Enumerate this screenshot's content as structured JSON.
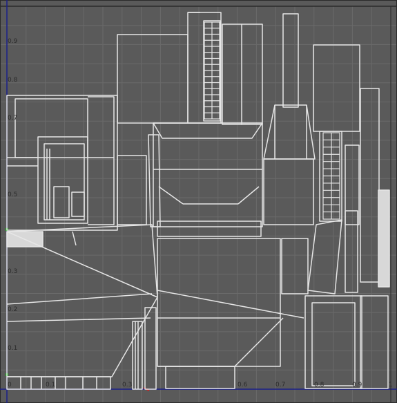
{
  "uv_editor": {
    "axis_ticks": {
      "v": [
        "0.9",
        "0.8",
        "0.7",
        "0.5",
        "0.3",
        "0.2",
        "0.1"
      ],
      "u": [
        "0",
        "0.1",
        "0.3",
        "0.6",
        "0.7",
        "0.8",
        "0.9",
        "1"
      ]
    },
    "colors": {
      "background": "#5a5a5a",
      "grid": "#6a6a6a",
      "border": "#2a2a2a",
      "axis": "#1b1f8a",
      "wire": "#e6e6e6",
      "u_axis_marker": "#cc2222",
      "v_axis_marker": "#22aa22"
    }
  }
}
